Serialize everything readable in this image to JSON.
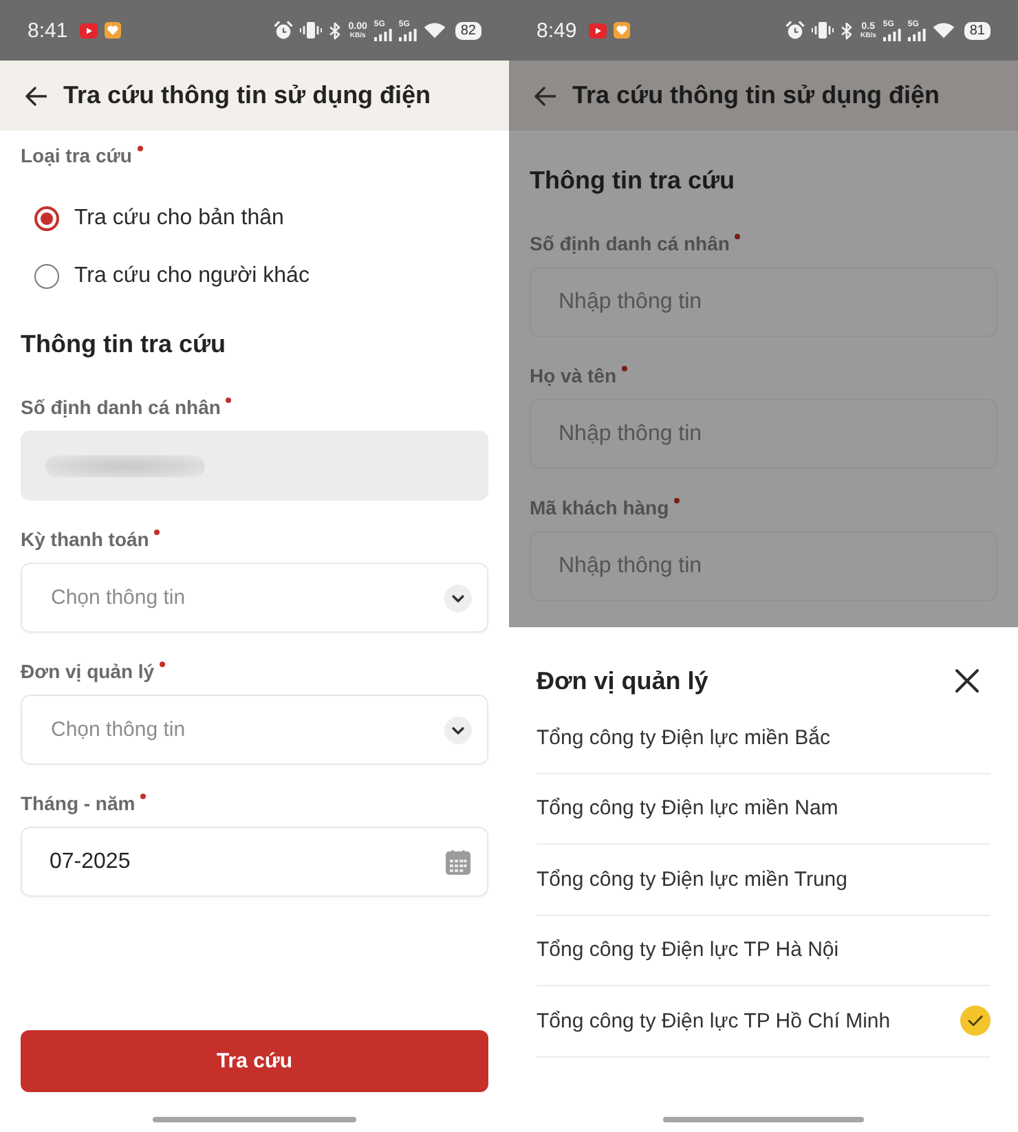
{
  "screens": [
    {
      "dimmed": false,
      "status_bar": {
        "time": "8:41",
        "speed_value": "0.00",
        "speed_unit": "KB/s",
        "network_types": [
          "5G",
          "5G"
        ],
        "battery": "82"
      },
      "header": {
        "title": "Tra cứu thông tin sử dụng điện"
      },
      "lookup_type": {
        "label": "Loại tra cứu",
        "required": true,
        "options": [
          {
            "label": "Tra cứu cho bản thân",
            "selected": true
          },
          {
            "label": "Tra cứu cho người khác",
            "selected": false
          }
        ]
      },
      "section_title": "Thông tin tra cứu",
      "fields": [
        {
          "label": "Số định danh cá nhân",
          "required": true,
          "kind": "masked"
        },
        {
          "label": "Kỳ thanh toán",
          "required": true,
          "kind": "select",
          "placeholder": "Chọn thông tin"
        },
        {
          "label": "Đơn vị quản lý",
          "required": true,
          "kind": "select",
          "placeholder": "Chọn thông tin"
        },
        {
          "label": "Tháng - năm",
          "required": true,
          "kind": "date",
          "value": "07-2025"
        }
      ],
      "submit_button": {
        "label": "Tra cứu"
      }
    },
    {
      "dimmed": true,
      "status_bar": {
        "time": "8:49",
        "speed_value": "0.5",
        "speed_unit": "KB/s",
        "network_types": [
          "5G",
          "5G"
        ],
        "battery": "81"
      },
      "header": {
        "title": "Tra cứu thông tin sử dụng điện"
      },
      "section_title": "Thông tin tra cứu",
      "fields": [
        {
          "label": "Số định danh cá nhân",
          "required": true,
          "kind": "text",
          "placeholder": "Nhập thông tin"
        },
        {
          "label": "Họ và tên",
          "required": true,
          "kind": "text",
          "placeholder": "Nhập thông tin"
        },
        {
          "label": "Mã khách hàng",
          "required": true,
          "kind": "text",
          "placeholder": "Nhập thông tin"
        }
      ],
      "sheet": {
        "title": "Đơn vị quản lý",
        "options": [
          {
            "label": "Tổng công ty Điện lực miền Bắc",
            "selected": false
          },
          {
            "label": "Tổng công ty Điện lực miền Nam",
            "selected": false
          },
          {
            "label": "Tổng công ty Điện lực miền Trung",
            "selected": false
          },
          {
            "label": "Tổng công ty Điện lực TP Hà Nội",
            "selected": false
          },
          {
            "label": "Tổng công ty Điện lực TP Hồ Chí Minh",
            "selected": true
          }
        ]
      }
    }
  ]
}
